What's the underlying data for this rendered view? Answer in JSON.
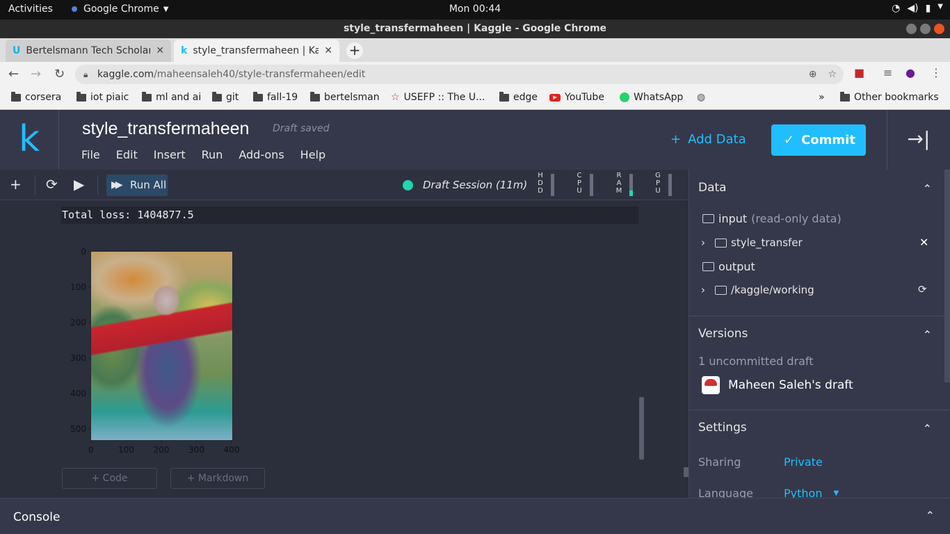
{
  "os_bar": {
    "activities": "Activities",
    "app_name": "Google Chrome",
    "clock": "Mon 00:44"
  },
  "window": {
    "title": "style_transfermaheen | Kaggle - Google Chrome"
  },
  "tabs": [
    {
      "label": "Bertelsmann Tech Scholar",
      "icon": "udacity-icon",
      "active": false
    },
    {
      "label": "style_transfermaheen | Ka",
      "icon": "kaggle-icon",
      "active": true
    }
  ],
  "address": {
    "domain": "kaggle.com",
    "path": "/maheensaleh40/style-transfermaheen/edit"
  },
  "bookmarks": [
    {
      "label": "corsera",
      "icon": "folder-icon"
    },
    {
      "label": "iot piaic",
      "icon": "folder-icon"
    },
    {
      "label": "ml and ai",
      "icon": "folder-icon"
    },
    {
      "label": "git",
      "icon": "folder-icon"
    },
    {
      "label": "fall-19",
      "icon": "folder-icon"
    },
    {
      "label": "bertelsman",
      "icon": "folder-icon"
    },
    {
      "label": "USEFP :: The U...",
      "icon": "star-icon"
    },
    {
      "label": "edge",
      "icon": "folder-icon"
    },
    {
      "label": "YouTube",
      "icon": "youtube-icon"
    },
    {
      "label": "WhatsApp",
      "icon": "whatsapp-icon"
    }
  ],
  "bookmarks_more": "»",
  "bookmarks_other": "Other bookmarks",
  "kaggle": {
    "logo": "k",
    "notebook_title": "style_transfermaheen",
    "draft_status": "Draft saved",
    "menu": [
      "File",
      "Edit",
      "Insert",
      "Run",
      "Add-ons",
      "Help"
    ],
    "add_data": "Add Data",
    "commit": "Commit"
  },
  "toolbar": {
    "run_all": "Run All",
    "session": "Draft Session (11m)",
    "meters": [
      {
        "label": "HDD",
        "level": 0.0
      },
      {
        "label": "CPU",
        "level": 0.0
      },
      {
        "label": "RAM",
        "level": 0.25
      },
      {
        "label": "GPU",
        "level": 0.0
      }
    ]
  },
  "cell_output": {
    "text": "Total loss:  1404877.5"
  },
  "plot": {
    "y_ticks": [
      "0",
      "100",
      "200",
      "300",
      "400",
      "500"
    ],
    "x_ticks": [
      "0",
      "100",
      "200",
      "300",
      "400"
    ]
  },
  "add_cell": {
    "code": "+ Code",
    "markdown": "+ Markdown"
  },
  "sidebar": {
    "data": {
      "title": "Data",
      "input_label": "input",
      "input_note": "(read-only data)",
      "input_item": "style_transfer",
      "output_label": "output",
      "output_item": "/kaggle/working"
    },
    "versions": {
      "title": "Versions",
      "uncommitted": "1 uncommitted draft",
      "draft_name": "Maheen Saleh's draft"
    },
    "settings": {
      "title": "Settings",
      "sharing_label": "Sharing",
      "sharing_value": "Private",
      "language_label": "Language",
      "language_value": "Python"
    }
  },
  "console": {
    "label": "Console"
  }
}
